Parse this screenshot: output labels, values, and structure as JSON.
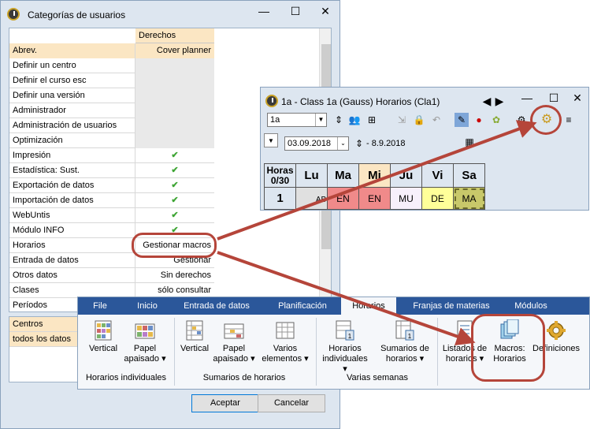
{
  "win1": {
    "title": "Categorías de usuarios",
    "column_header": "Derechos",
    "rows": [
      {
        "label": "Abrev.",
        "value": "Cover planner"
      },
      {
        "label": "Definir un centro",
        "value": ""
      },
      {
        "label": "Definir el curso esc",
        "value": ""
      },
      {
        "label": "Definir una versión",
        "value": ""
      },
      {
        "label": "Administrador",
        "value": ""
      },
      {
        "label": "Administración de usuarios",
        "value": ""
      },
      {
        "label": "Optimización",
        "value": ""
      },
      {
        "label": "Impresión",
        "value": "✔"
      },
      {
        "label": "Estadística: Sust.",
        "value": "✔"
      },
      {
        "label": "Exportación de datos",
        "value": "✔"
      },
      {
        "label": "Importación de datos",
        "value": "✔"
      },
      {
        "label": "WebUntis",
        "value": "✔"
      },
      {
        "label": "Módulo INFO",
        "value": "✔"
      },
      {
        "label": "Horarios",
        "value": "Gestionar macros"
      },
      {
        "label": "Entrada de datos",
        "value": "Gestionar"
      },
      {
        "label": "Otros datos",
        "value": "Sin derechos"
      },
      {
        "label": "Clases",
        "value": "sólo consultar"
      },
      {
        "label": "Períodos",
        "value": ""
      }
    ],
    "lower_rows": [
      "Centros",
      "todos los datos"
    ],
    "ok_label": "Aceptar",
    "cancel_label": "Cancelar"
  },
  "win2": {
    "title": "1a - Class 1a (Gauss)  Horarios  (Cla1)",
    "class_combo": "1a",
    "date_combo": "03.09.2018",
    "date_end": "- 8.9.2018",
    "hours_label_1": "Horas",
    "hours_label_2": "0/30",
    "days": [
      "Lu",
      "Ma",
      "Mi",
      "Ju",
      "Vi",
      "Sa"
    ],
    "row_number": "1",
    "cells": [
      "",
      "EN",
      "EN",
      "MU",
      "DE",
      "MA"
    ],
    "partial_cell": "AB"
  },
  "ribbon": {
    "tabs": [
      "File",
      "Inicio",
      "Entrada de datos",
      "Planificación",
      "Horarios",
      "Franjas de materias",
      "Módulos"
    ],
    "items": [
      {
        "label1": "Vertical",
        "label2": ""
      },
      {
        "label1": "Papel",
        "label2": "apaisado ▾"
      },
      {
        "label1": "Vertical",
        "label2": ""
      },
      {
        "label1": "Papel",
        "label2": "apaisado ▾"
      },
      {
        "label1": "Varios",
        "label2": "elementos ▾"
      },
      {
        "label1": "Horarios",
        "label2": "individuales ▾"
      },
      {
        "label1": "Sumarios de",
        "label2": "horarios ▾"
      },
      {
        "label1": "Listados de",
        "label2": "horarios ▾"
      },
      {
        "label1": "Macros:",
        "label2": "Horarios"
      },
      {
        "label1": "Definiciones",
        "label2": ""
      }
    ],
    "groups": [
      "Horarios individuales",
      "Sumarios de horarios",
      "Varias semanas"
    ]
  },
  "colors": {
    "accent_red": "#b5453a",
    "ribbon_blue": "#2b579a",
    "highlight_orange": "#fbe6c3",
    "check_green": "#3fa535"
  }
}
